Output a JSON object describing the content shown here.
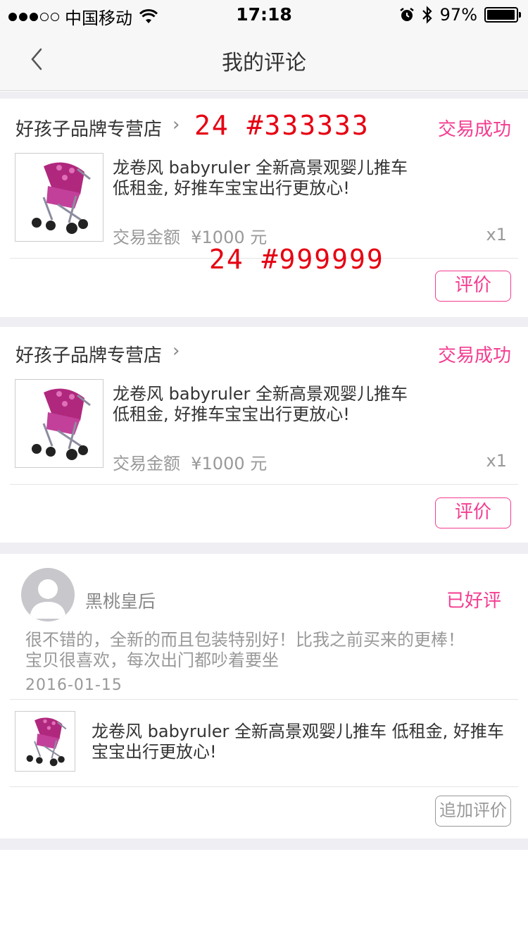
{
  "status_bar": {
    "carrier": "中国移动",
    "time": "17:18",
    "battery_text": "97%",
    "battery_level": 0.97
  },
  "nav": {
    "title": "我的评论"
  },
  "orders": [
    {
      "shop_name": "好孩子品牌专营店",
      "status": "交易成功",
      "product_title_line1": "龙卷风 babyruler  全新高景观婴儿推车",
      "product_title_line2": "低租金, 好推车宝宝出行更放心!",
      "amount_label": "交易金额",
      "amount": "¥1000 元",
      "quantity": "x1",
      "action_label": "评价"
    },
    {
      "shop_name": "好孩子品牌专营店",
      "status": "交易成功",
      "product_title_line1": "龙卷风 babyruler  全新高景观婴儿推车",
      "product_title_line2": "低租金, 好推车宝宝出行更放心!",
      "amount_label": "交易金额",
      "amount": "¥1000 元",
      "quantity": "x1",
      "action_label": "评价"
    }
  ],
  "review": {
    "user_name": "黑桃皇后",
    "status": "已好评",
    "text_line1": "很不错的，全新的而且包装特别好！比我之前买来的更棒！",
    "text_line2": "宝贝很喜欢，每次出门都吵着要坐",
    "date": "2016-01-15",
    "product_title_line1": "龙卷风 babyruler  全新高景观婴儿推车 低租金, 好推车",
    "product_title_line2": "宝宝出行更放心!",
    "action_label": "追加评价"
  },
  "annotations": {
    "label_1": "24 #333333",
    "label_2": "24 #999999"
  },
  "colors": {
    "accent": "#f43c90",
    "text_primary": "#333333",
    "text_secondary": "#999999",
    "annotation": "#e60012",
    "section_gap": "#eeeef3"
  },
  "icons": {
    "back": "chevron-left-icon",
    "shop_arrow": "chevron-right-icon",
    "alarm": "alarm-icon",
    "bluetooth": "bluetooth-icon",
    "wifi": "wifi-icon",
    "avatar": "user-avatar-icon"
  }
}
